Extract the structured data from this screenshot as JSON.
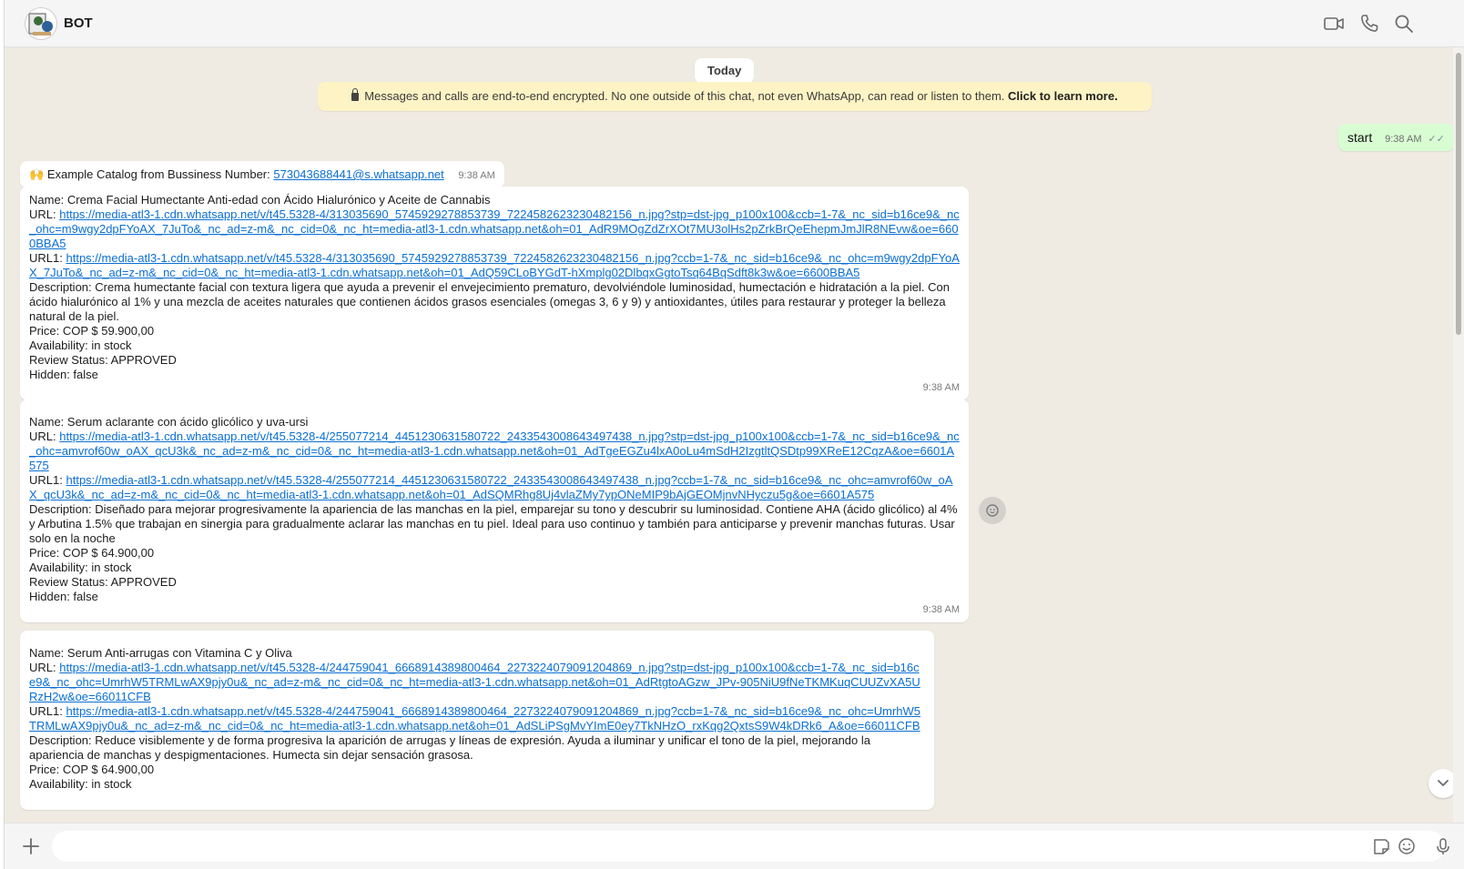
{
  "header": {
    "chat_name": "BOT",
    "icons": [
      "video-call-icon",
      "voice-call-icon",
      "search-icon"
    ]
  },
  "chat": {
    "date_label": "Today",
    "encryption_notice": {
      "text": "Messages and calls are end-to-end encrypted. No one outside of this chat, not even WhatsApp, can read or listen to them.",
      "link": "Click to learn more."
    },
    "outgoing": {
      "text": "start",
      "time": "9:38 AM",
      "status": "read"
    },
    "intro": {
      "emoji": "🙌",
      "text": "Example Catalog from Bussiness Number:",
      "link": "573043688441@s.whatsapp.net",
      "time": "9:38 AM"
    },
    "products": [
      {
        "name": "Name: Crema Facial Humectante Anti-edad con Ácido Hialurónico y Aceite de Cannabis",
        "url_label": "URL:",
        "url": "https://media-atl3-1.cdn.whatsapp.net/v/t45.5328-4/313035690_5745929278853739_7224582623230482156_n.jpg?stp=dst-jpg_p100x100&ccb=1-7&_nc_sid=b16ce9&_nc_ohc=m9wgy2dpFYoAX_7JuTo&_nc_ad=z-m&_nc_cid=0&_nc_ht=media-atl3-1.cdn.whatsapp.net&oh=01_AdR9MOgZdZrXOt7MU3olHs2pZrkBrQeEhepmJmJlR8NEvw&oe=6600BBA5",
        "url1_label": "URL1:",
        "url1": "https://media-atl3-1.cdn.whatsapp.net/v/t45.5328-4/313035690_5745929278853739_7224582623230482156_n.jpg?ccb=1-7&_nc_sid=b16ce9&_nc_ohc=m9wgy2dpFYoAX_7JuTo&_nc_ad=z-m&_nc_cid=0&_nc_ht=media-atl3-1.cdn.whatsapp.net&oh=01_AdQ59CLoBYGdT-hXmplg02DlbqxGgtoTsq64BqSdft8k3w&oe=6600BBA5",
        "description": "Description: Crema humectante facial con textura ligera que ayuda a prevenir el envejecimiento prematuro, devolviéndole luminosidad, humectación e hidratación a la piel. Con ácido hialurónico al 1% y una mezcla de aceites naturales que contienen ácidos grasos esenciales (omegas 3, 6 y 9) y antioxidantes, útiles para restaurar y proteger la belleza natural de la piel.",
        "price": "Price: COP $ 59.900,00",
        "availability": "Availability: in stock",
        "review_status": "Review Status: APPROVED",
        "hidden": "Hidden: false",
        "time": "9:38 AM"
      },
      {
        "name": "Name: Serum aclarante con ácido glicólico y uva-ursi",
        "url_label": "URL:",
        "url": "https://media-atl3-1.cdn.whatsapp.net/v/t45.5328-4/255077214_4451230631580722_2433543008643497438_n.jpg?stp=dst-jpg_p100x100&ccb=1-7&_nc_sid=b16ce9&_nc_ohc=amvrof60w_oAX_qcU3k&_nc_ad=z-m&_nc_cid=0&_nc_ht=media-atl3-1.cdn.whatsapp.net&oh=01_AdTgeEGZu4lxA0oLu4mSdH2IzgtltQSDtp99XReE12CqzA&oe=6601A575",
        "url1_label": "URL1:",
        "url1": "https://media-atl3-1.cdn.whatsapp.net/v/t45.5328-4/255077214_4451230631580722_2433543008643497438_n.jpg?ccb=1-7&_nc_sid=b16ce9&_nc_ohc=amvrof60w_oAX_qcU3k&_nc_ad=z-m&_nc_cid=0&_nc_ht=media-atl3-1.cdn.whatsapp.net&oh=01_AdSQMRhg8Uj4vlaZMy7ypONeMIP9bAjGEOMjnvNHyczu5g&oe=6601A575",
        "description": "Description: Diseñado para mejorar progresivamente la apariencia de las manchas en la piel, emparejar su tono y descubrir su luminosidad. Contiene AHA (ácido glicólico) al 4% y Arbutina 1.5% que trabajan en sinergia para gradualmente aclarar las manchas en tu piel. Ideal para uso continuo y también para anticiparse y prevenir manchas futuras. Usar solo en la noche",
        "price": "Price: COP $ 64.900,00",
        "availability": "Availability: in stock",
        "review_status": "Review Status: APPROVED",
        "hidden": "Hidden: false",
        "time": "9:38 AM"
      },
      {
        "name": "Name: Serum Anti-arrugas con Vitamina C y Oliva",
        "url_label": "URL:",
        "url": "https://media-atl3-1.cdn.whatsapp.net/v/t45.5328-4/244759041_6668914389800464_2273224079091204869_n.jpg?stp=dst-jpg_p100x100&ccb=1-7&_nc_sid=b16ce9&_nc_ohc=UmrhW5TRMLwAX9pjy0u&_nc_ad=z-m&_nc_cid=0&_nc_ht=media-atl3-1.cdn.whatsapp.net&oh=01_AdRtgtoAGzw_JPv-905NiU9fNeTKMKuqCUUZvXA5URzH2w&oe=66011CFB",
        "url1_label": "URL1:",
        "url1": "https://media-atl3-1.cdn.whatsapp.net/v/t45.5328-4/244759041_6668914389800464_2273224079091204869_n.jpg?ccb=1-7&_nc_sid=b16ce9&_nc_ohc=UmrhW5TRMLwAX9pjy0u&_nc_ad=z-m&_nc_cid=0&_nc_ht=media-atl3-1.cdn.whatsapp.net&oh=01_AdSLiPSgMvYImE0ey7TkNHzO_rxKqg2QxtsS9W4kDRk6_A&oe=66011CFB",
        "description": "Description: Reduce visiblemente y de forma progresiva la aparición de arrugas y líneas de expresión. Ayuda a iluminar y unificar el tono de la piel, mejorando la apariencia de manchas y despigmentaciones. Humecta sin dejar sensación grasosa.",
        "price": "Price: COP $ 64.900,00",
        "availability": "Availability: in stock"
      }
    ]
  },
  "footer": {
    "input_placeholder": "",
    "icons": [
      "plus-icon",
      "sticker-icon",
      "emoji-icon",
      "microphone-icon"
    ]
  },
  "colors": {
    "chat_background": "#efeae2",
    "outgoing_bubble": "#d9fdd3",
    "incoming_bubble": "#ffffff",
    "notice_background": "#fdf3c4",
    "link": "#0a6fd4"
  }
}
